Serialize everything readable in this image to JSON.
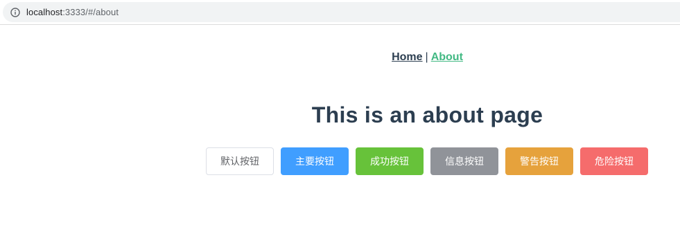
{
  "browser": {
    "url_host": "localhost",
    "url_rest": ":3333/#/about",
    "info_icon": "info-circle-icon"
  },
  "nav": {
    "home_label": "Home",
    "separator": "|",
    "about_label": "About"
  },
  "page": {
    "title": "This is an about page"
  },
  "buttons": [
    {
      "label": "默认按钮",
      "type": "default"
    },
    {
      "label": "主要按钮",
      "type": "primary"
    },
    {
      "label": "成功按钮",
      "type": "success"
    },
    {
      "label": "信息按钮",
      "type": "info"
    },
    {
      "label": "警告按钮",
      "type": "warning"
    },
    {
      "label": "危险按钮",
      "type": "danger"
    }
  ],
  "colors": {
    "default_bg": "#ffffff",
    "primary": "#409eff",
    "success": "#67c23a",
    "info": "#909399",
    "warning": "#e6a23c",
    "danger": "#f56c6c",
    "nav_active": "#42b983",
    "text": "#2c3e50"
  }
}
